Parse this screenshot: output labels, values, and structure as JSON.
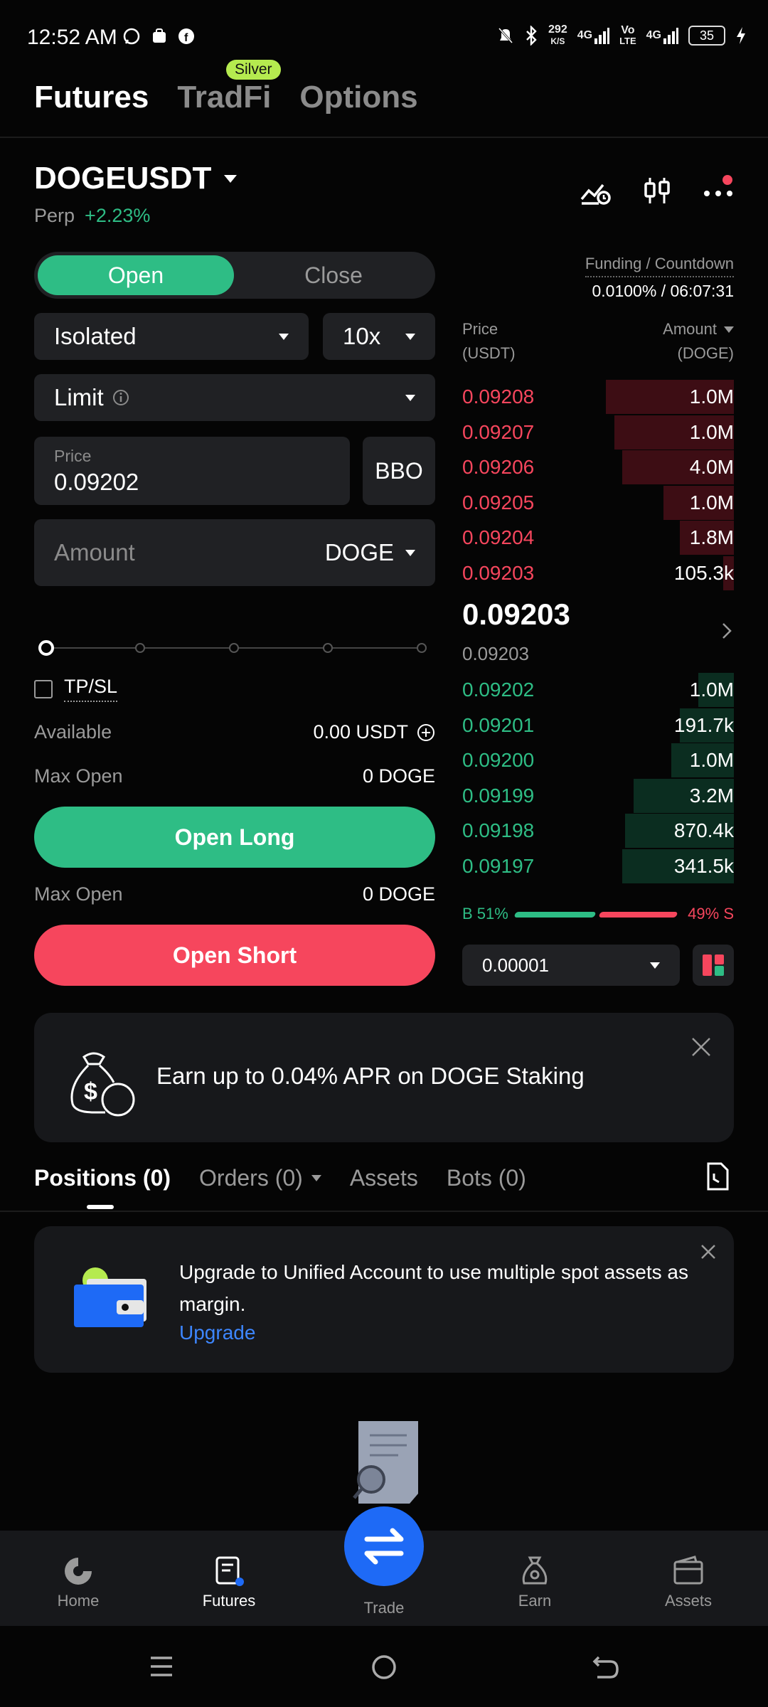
{
  "status_bar": {
    "time": "12:52 AM",
    "net_speed_top": "292",
    "net_speed_bottom": "K/S",
    "signal1": "4G",
    "volte_top": "Vo",
    "volte_bottom": "LTE",
    "signal2": "4G",
    "battery": "35"
  },
  "top_tabs": [
    "Futures",
    "TradFi",
    "Options"
  ],
  "silver_badge": "Silver",
  "symbol": {
    "name": "DOGEUSDT",
    "type": "Perp",
    "change": "+2.23%"
  },
  "order_form": {
    "open_label": "Open",
    "close_label": "Close",
    "margin_mode": "Isolated",
    "leverage": "10x",
    "order_type": "Limit",
    "price_label": "Price",
    "price_value": "0.09202",
    "bbo_label": "BBO",
    "amount_placeholder": "Amount",
    "amount_unit": "DOGE",
    "tpsl_label": "TP/SL",
    "available_label": "Available",
    "available_value": "0.00 USDT",
    "max_open_label": "Max Open",
    "max_open_long": "0 DOGE",
    "max_open_short": "0 DOGE",
    "open_long_label": "Open Long",
    "open_short_label": "Open Short",
    "slider_level": 0
  },
  "order_book": {
    "funding_label": "Funding / Countdown",
    "funding_value": "0.0100% / 06:07:31",
    "price_header": "Price",
    "price_unit": "(USDT)",
    "amount_header": "Amount",
    "amount_unit": "(DOGE)",
    "asks": [
      {
        "price": "0.09208",
        "amount": "1.0M",
        "depth": 0.47
      },
      {
        "price": "0.09207",
        "amount": "1.0M",
        "depth": 0.44
      },
      {
        "price": "0.09206",
        "amount": "4.0M",
        "depth": 0.41
      },
      {
        "price": "0.09205",
        "amount": "1.0M",
        "depth": 0.26
      },
      {
        "price": "0.09204",
        "amount": "1.8M",
        "depth": 0.2
      },
      {
        "price": "0.09203",
        "amount": "105.3k",
        "depth": 0.04
      }
    ],
    "last_price": "0.09203",
    "mark_price": "0.09203",
    "bids": [
      {
        "price": "0.09202",
        "amount": "1.0M",
        "depth": 0.13
      },
      {
        "price": "0.09201",
        "amount": "191.7k",
        "depth": 0.2
      },
      {
        "price": "0.09200",
        "amount": "1.0M",
        "depth": 0.23
      },
      {
        "price": "0.09199",
        "amount": "3.2M",
        "depth": 0.37
      },
      {
        "price": "0.09198",
        "amount": "870.4k",
        "depth": 0.4
      },
      {
        "price": "0.09197",
        "amount": "341.5k",
        "depth": 0.41
      }
    ],
    "buy_ratio_label": "B 51%",
    "sell_ratio_label": "49% S",
    "buy_ratio": 0.51,
    "precision": "0.00001"
  },
  "promo": {
    "text": "Earn up to 0.04% APR on DOGE Staking"
  },
  "bottom_tabs": [
    "Positions (0)",
    "Orders (0)",
    "Assets",
    "Bots (0)"
  ],
  "upgrade_banner": {
    "text": "Upgrade to Unified Account to use multiple spot assets as margin.",
    "link": "Upgrade"
  },
  "bottom_nav": [
    "Home",
    "Futures",
    "Trade",
    "Earn",
    "Assets"
  ],
  "colors": {
    "green": "#2ebd85",
    "red": "#f6465d",
    "accent_blue": "#1e6af6",
    "silver_badge": "#b5ea4f"
  }
}
